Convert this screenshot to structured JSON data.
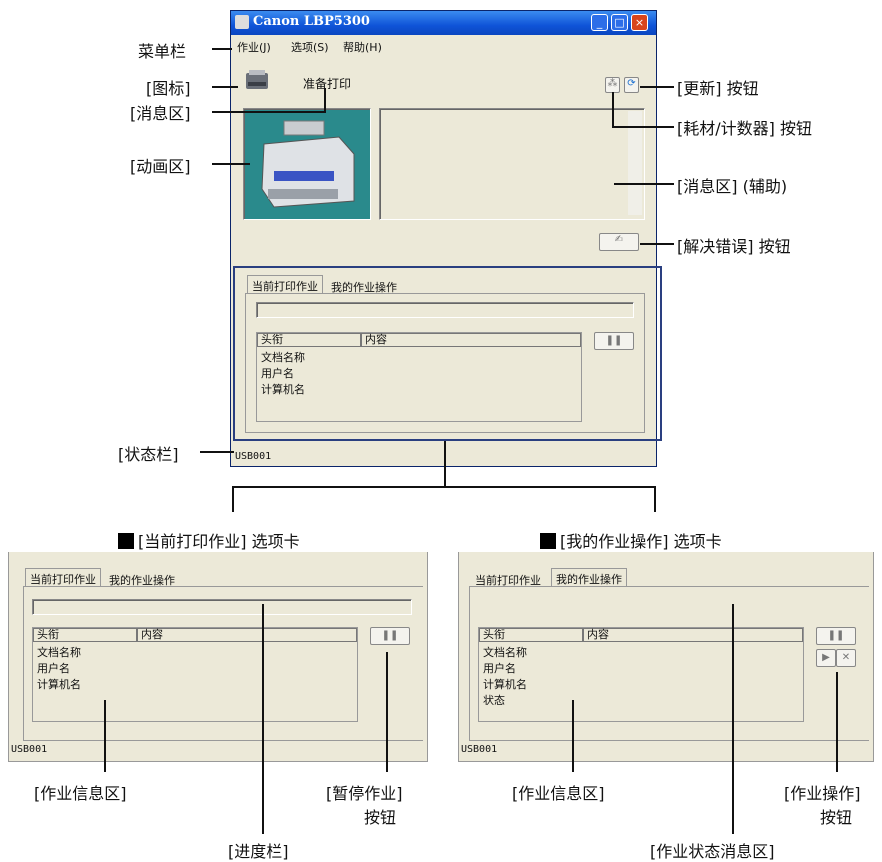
{
  "window": {
    "title": "Canon LBP5300",
    "menu": [
      "作业(J)",
      "选项(S)",
      "帮助(H)"
    ],
    "message": "准备打印",
    "tabs": [
      "当前打印作业",
      "我的作业操作"
    ],
    "columns": [
      "头衔",
      "内容"
    ],
    "rows": [
      "文档名称",
      "用户名",
      "计算机名"
    ],
    "status": "USB001"
  },
  "callouts": {
    "menubar": "菜单栏",
    "icon": "[图标]",
    "message_area": "[消息区]",
    "animation_area": "[动画区]",
    "status_bar": "[状态栏]",
    "refresh_button": "[更新] 按钮",
    "consumables_button": "[耗材/计数器] 按钮",
    "message_area_aux": "[消息区] (辅助)",
    "resolve_error_button": "[解决错误] 按钮"
  },
  "panel_left": {
    "heading": "[当前打印作业] 选项卡",
    "tabs": [
      "当前打印作业",
      "我的作业操作"
    ],
    "columns": [
      "头衔",
      "内容"
    ],
    "rows": [
      "文档名称",
      "用户名",
      "计算机名"
    ],
    "status": "USB001",
    "callout_job_info": "[作业信息区]",
    "callout_pause_1": "[暂停作业]",
    "callout_pause_2": "按钮",
    "callout_progress": "[进度栏]"
  },
  "panel_right": {
    "heading": "[我的作业操作] 选项卡",
    "tabs": [
      "当前打印作业",
      "我的作业操作"
    ],
    "columns": [
      "头衔",
      "内容"
    ],
    "rows": [
      "文档名称",
      "用户名",
      "计算机名",
      "状态"
    ],
    "status": "USB001",
    "callout_job_info": "[作业信息区]",
    "callout_ops_1": "[作业操作]",
    "callout_ops_2": "按钮",
    "callout_status_msg": "[作业状态消息区]"
  },
  "colors": {
    "title_bar": "#0f54d8",
    "window_bg": "#ece9d8",
    "outline": "#2a3f80"
  },
  "icons": [
    "printer-icon",
    "refresh-icon",
    "consumables-icon",
    "resolve-error-icon",
    "pause-icon",
    "resume-icon",
    "delete-icon"
  ]
}
